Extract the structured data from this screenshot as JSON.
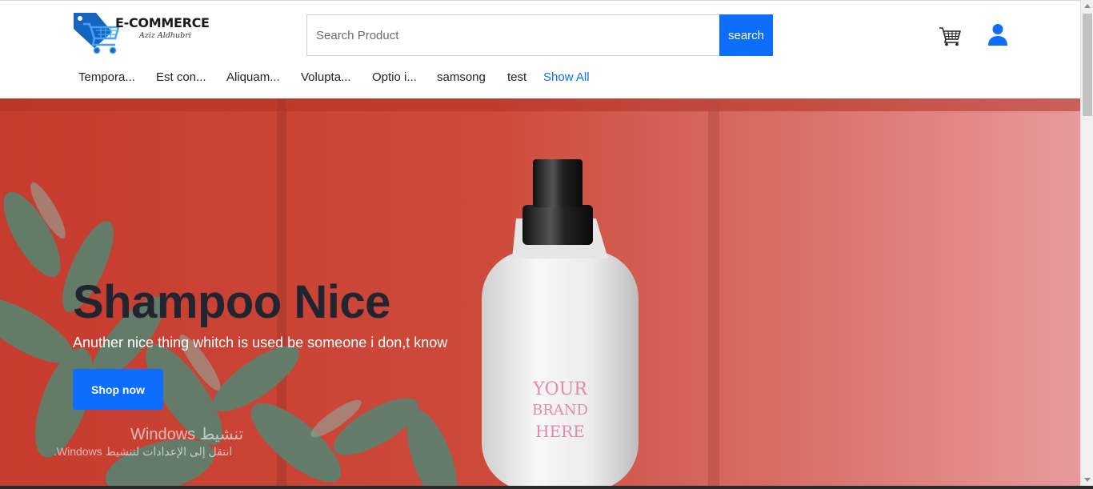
{
  "brand": {
    "name": "E-COMMERCE",
    "tagline": "Aziz Aldhubri"
  },
  "search": {
    "placeholder": "Search Product",
    "value": "",
    "button_label": "search"
  },
  "header_icons": [
    "cart-icon",
    "user-icon"
  ],
  "categories": [
    "Tempora...",
    "Est con...",
    "Aliquam...",
    "Volupta...",
    "Optio i...",
    "samsong",
    "test"
  ],
  "show_all_label": "Show All",
  "hero": {
    "title": "Shampoo Nice",
    "subtitle": "Anuther nice thing whitch is used be someone i don,t know",
    "button_label": "Shop now"
  },
  "watermark": {
    "title": "تنشيط Windows",
    "subtitle": "انتقل إلى الإعدادات لتنشيط Windows."
  },
  "colors": {
    "accent": "#0d6efd",
    "hero_wall": "#c9473a",
    "title_text": "#222530"
  }
}
